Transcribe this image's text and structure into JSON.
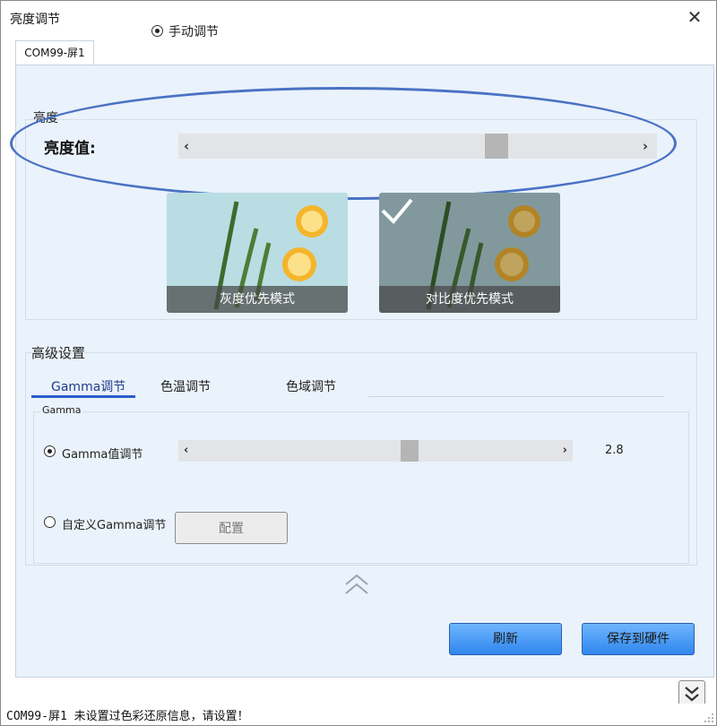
{
  "window": {
    "title": "亮度调节",
    "close_glyph": "✕"
  },
  "tabs": [
    {
      "label": "COM99-屏1"
    }
  ],
  "brightness": {
    "mode_radio_label": "手动调节",
    "group_label": "亮度",
    "label": "亮度值:",
    "slider_left_arrow": "‹",
    "slider_right_arrow": "›",
    "slider_level_fraction": 0.65
  },
  "modes": [
    {
      "label": "灰度优先模式",
      "selected": false
    },
    {
      "label": "对比度优先模式",
      "selected": true
    }
  ],
  "advanced": {
    "label": "高级设置",
    "subtabs": [
      {
        "label": "Gamma调节",
        "active": true
      },
      {
        "label": "色温调节",
        "active": false
      },
      {
        "label": "色域调节",
        "active": false
      }
    ],
    "gamma_group_label": "Gamma",
    "gamma_value_radio_label": "Gamma值调节",
    "gamma_slider_left_arrow": "‹",
    "gamma_slider_right_arrow": "›",
    "gamma_value": "2.8",
    "custom_gamma_radio_label": "自定义Gamma调节",
    "config_button": "配置"
  },
  "buttons": {
    "refresh": "刷新",
    "save_to_hardware": "保存到硬件"
  },
  "status": {
    "message": "COM99-屏1 未设置过色彩还原信息，请设置！"
  },
  "icons": {
    "close": "close-icon",
    "collapse": "double-chevron-up-icon",
    "expand": "double-chevron-down-icon",
    "check": "check-icon"
  },
  "colors": {
    "panel_background": "#eaf2fb",
    "accent_blue": "#2f86ee",
    "highlight_ellipse": "#4a72c4"
  }
}
